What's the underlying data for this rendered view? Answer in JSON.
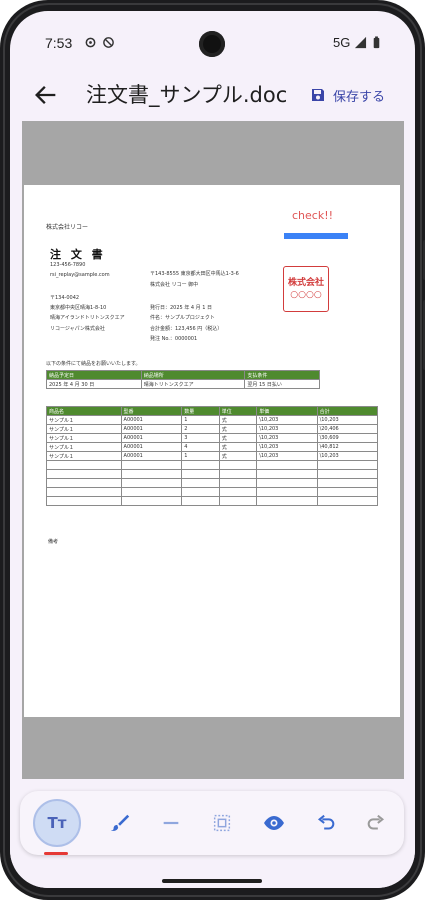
{
  "status": {
    "time": "7:53",
    "network": "5G"
  },
  "appbar": {
    "title": "注文書_サンプル.docx",
    "save_label": "保存する"
  },
  "document": {
    "client": "株式会社リコー",
    "order_title": "注 文 書",
    "phone": "123-456-7890",
    "email": "rsi_replay@sample.com",
    "postal_left": "〒134-0042",
    "address_left": "東京都中央区晴海1-8-10",
    "building_left": "晴海アイランドトリトンスクエア",
    "company_left": "リコージャパン株式会社",
    "postal_right": "〒143-8555 東京都大田区中馬込1-3-6",
    "company_right": "株式会社 リコー 御中",
    "date_line": "発行日：2025 年 4 月 1 日",
    "subject_line": "件名：サンプルプロジェクト",
    "amount_line": "合計金額：123,456 円（税込）",
    "order_no_line": "発注 No.：0000001",
    "check_note": "check!!",
    "stamp_line1": "株式会社",
    "stamp_line2": "○○○○",
    "intro": "以下の条件にて納品をお願いいたします。",
    "terms_headers": [
      "納品予定日",
      "納品場所",
      "支払条件"
    ],
    "terms_values": [
      "2025 年 4 月 30 日",
      "晴海トリトンスクエア",
      "翌月 15 日払い"
    ],
    "items_headers": [
      "商品名",
      "型番",
      "数量",
      "単位",
      "単価",
      "合計"
    ],
    "items_rows": [
      [
        "サンプル１",
        "A00001",
        "1",
        "式",
        "\\10,203",
        "\\10,203"
      ],
      [
        "サンプル１",
        "A00001",
        "2",
        "式",
        "\\10,203",
        "\\20,406"
      ],
      [
        "サンプル１",
        "A00001",
        "3",
        "式",
        "\\10,203",
        "\\30,609"
      ],
      [
        "サンプル１",
        "A00001",
        "4",
        "式",
        "\\10,203",
        "\\40,812"
      ],
      [
        "サンプル１",
        "A00001",
        "1",
        "式",
        "\\10,203",
        "\\10,203"
      ]
    ],
    "empty_rows": 5,
    "remarks_label": "備考"
  },
  "toolbar": {
    "text_tool_label": "Tт",
    "tools": [
      "text-tool",
      "brush-tool",
      "line-tool",
      "select-tool",
      "view-tool",
      "undo-tool",
      "redo-tool"
    ]
  },
  "colors": {
    "accent": "#3a45a8",
    "stamp": "#d23c3c",
    "table_header": "#4f8a2f",
    "check_note": "#e05555",
    "highlight_bar": "#3b82f6"
  }
}
